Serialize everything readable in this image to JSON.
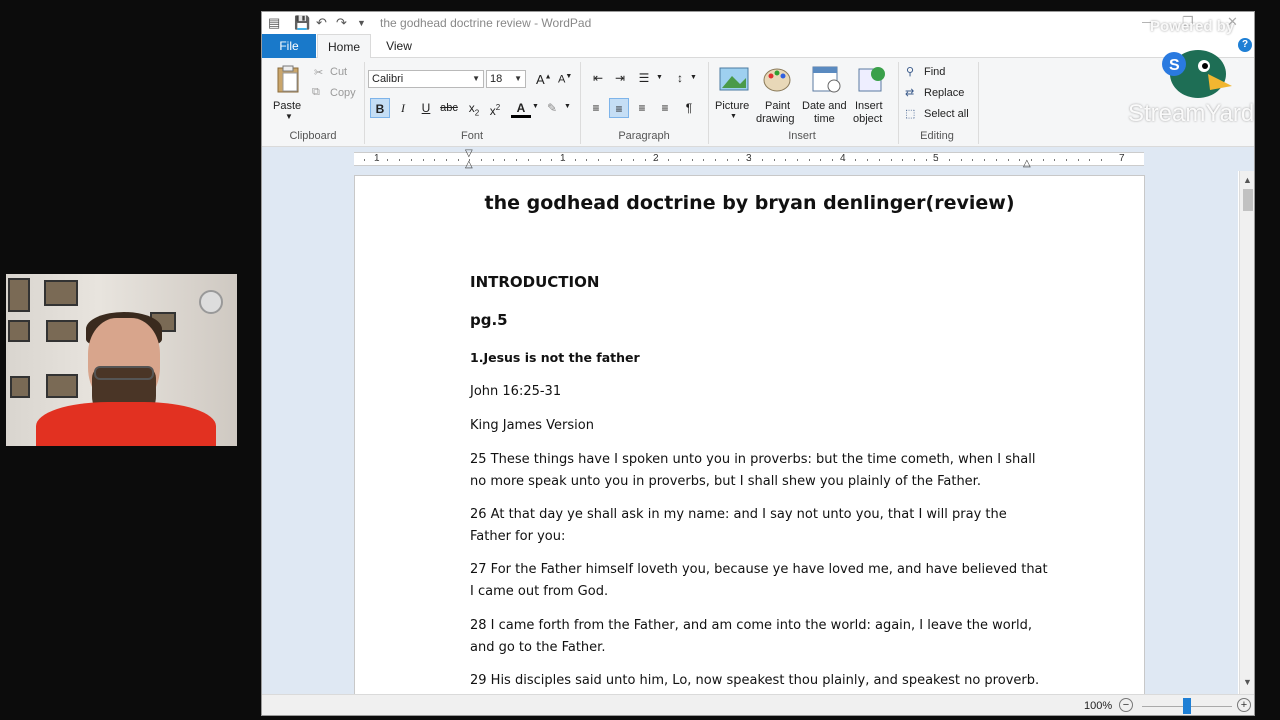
{
  "window": {
    "title": "the godhead doctrine review - WordPad"
  },
  "tabs": {
    "file": "File",
    "home": "Home",
    "view": "View"
  },
  "ribbon": {
    "clipboard": {
      "paste": "Paste",
      "cut": "Cut",
      "copy": "Copy",
      "label": "Clipboard"
    },
    "font": {
      "family": "Calibri",
      "size": "18",
      "label": "Font"
    },
    "paragraph": {
      "label": "Paragraph"
    },
    "insert": {
      "picture": "Picture",
      "paint_line1": "Paint",
      "paint_line2": "drawing",
      "datetime_line1": "Date and",
      "datetime_line2": "time",
      "object_line1": "Insert",
      "object_line2": "object",
      "label": "Insert"
    },
    "editing": {
      "find": "Find",
      "replace": "Replace",
      "select_all": "Select all",
      "label": "Editing"
    }
  },
  "ruler": {
    "numbers": [
      "1",
      "1",
      "2",
      "3",
      "4",
      "5",
      "7"
    ]
  },
  "document": {
    "title": "the godhead doctrine by bryan denlinger(review)",
    "heading": "INTRODUCTION",
    "page_ref": "pg.5",
    "point": "1.Jesus is not the father",
    "reference": "John 16:25-31",
    "version": "King James Version",
    "verses": [
      "25 These things have I spoken unto you in proverbs: but the time cometh, when I shall no more speak unto you in proverbs, but I shall shew you plainly of the Father.",
      "26 At that day ye shall ask in my name: and I say not unto you, that I will pray the Father for you:",
      "27 For the Father himself loveth you, because ye have loved me, and have believed that I came out from God.",
      "28 I came forth from the Father, and am come into the world: again, I leave the world, and go to the Father.",
      "29 His disciples said unto him, Lo, now speakest thou plainly, and speakest no proverb."
    ]
  },
  "status": {
    "zoom": "100%",
    "zoom_level": 0.5
  },
  "overlay": {
    "powered_by": "Powered by",
    "brand": "StreamYard"
  },
  "colors": {
    "file_tab": "#1979ca",
    "accent": "#1e7fd5",
    "shirt": "#e23121"
  }
}
